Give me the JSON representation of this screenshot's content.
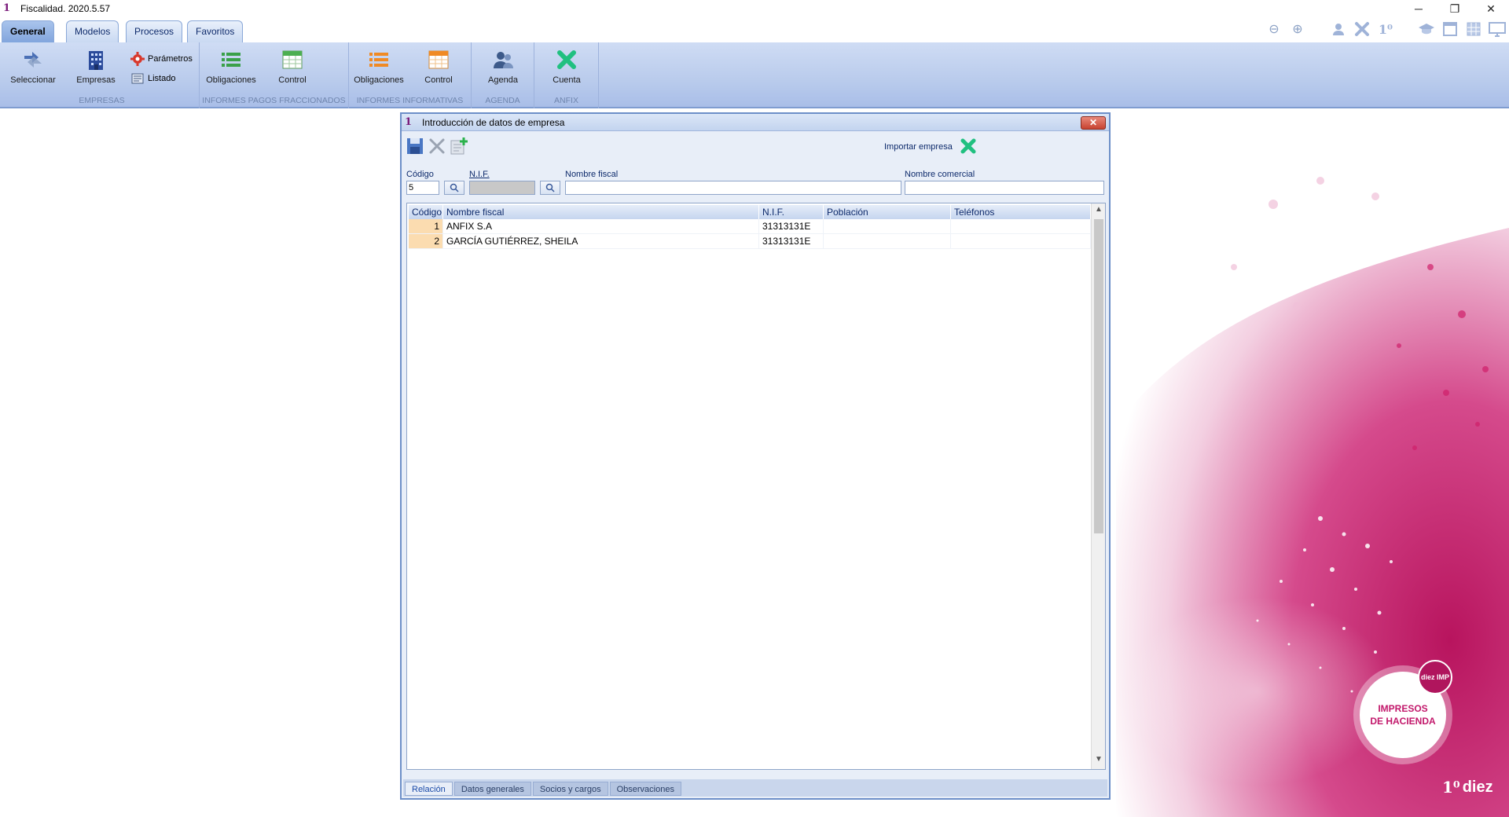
{
  "app": {
    "title": "Fiscalidad. 2020.5.57"
  },
  "window_controls": {
    "minimize": "─",
    "restore": "❐",
    "close": "✕"
  },
  "ribbon_tabs": [
    {
      "label": "General"
    },
    {
      "label": "Modelos"
    },
    {
      "label": "Procesos"
    },
    {
      "label": "Favoritos"
    }
  ],
  "ribbon": {
    "groups": [
      {
        "label": "EMPRESAS",
        "buttons": [
          "Seleccionar",
          "Empresas"
        ],
        "small_buttons": [
          "Parámetros",
          "Listado"
        ]
      },
      {
        "label": "INFORMES PAGOS FRACCIONADOS",
        "buttons": [
          "Obligaciones",
          "Control"
        ]
      },
      {
        "label": "INFORMES INFORMATIVAS",
        "buttons": [
          "Obligaciones",
          "Control"
        ]
      },
      {
        "label": "AGENDA",
        "buttons": [
          "Agenda"
        ]
      },
      {
        "label": "ANFIX",
        "buttons": [
          "Cuenta"
        ]
      }
    ]
  },
  "dialog": {
    "title": "Introducción de datos de empresa",
    "import_label": "Importar empresa",
    "fields": {
      "codigo_label": "Código",
      "codigo_value": "5",
      "nif_label": "N.I.F.",
      "nif_value": "",
      "nombre_fiscal_label": "Nombre fiscal",
      "nombre_fiscal_value": "",
      "nombre_comercial_label": "Nombre comercial",
      "nombre_comercial_value": ""
    },
    "grid": {
      "columns": [
        "Código",
        "Nombre fiscal",
        "N.I.F.",
        "Población",
        "Teléfonos"
      ],
      "rows": [
        {
          "codigo": "1",
          "nombre": "ANFIX S.A",
          "nif": "31313131E",
          "poblacion": "",
          "telefonos": ""
        },
        {
          "codigo": "2",
          "nombre": "GARCÍA GUTIÉRREZ, SHEILA",
          "nif": "31313131E",
          "poblacion": "",
          "telefonos": ""
        }
      ]
    },
    "bottom_tabs": [
      "Relación",
      "Datos generales",
      "Socios y cargos",
      "Observaciones"
    ]
  },
  "branding": {
    "badge_small": "diez IMP",
    "badge_line1": "IMPRESOS",
    "badge_line2": "DE HACIENDA",
    "logo": "diez"
  },
  "colors": {
    "accent": "#7fa3dc",
    "brand_magenta": "#c2186b",
    "anfix_green": "#20c080",
    "row_code_bg": "#fbdcb0"
  }
}
